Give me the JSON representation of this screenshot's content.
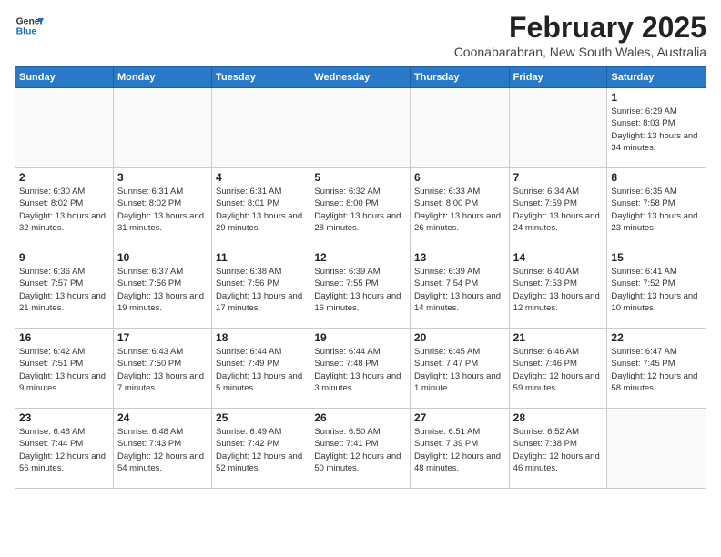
{
  "logo": {
    "line1": "General",
    "line2": "Blue"
  },
  "title": "February 2025",
  "location": "Coonabarabran, New South Wales, Australia",
  "days_of_week": [
    "Sunday",
    "Monday",
    "Tuesday",
    "Wednesday",
    "Thursday",
    "Friday",
    "Saturday"
  ],
  "weeks": [
    [
      {
        "day": "",
        "info": ""
      },
      {
        "day": "",
        "info": ""
      },
      {
        "day": "",
        "info": ""
      },
      {
        "day": "",
        "info": ""
      },
      {
        "day": "",
        "info": ""
      },
      {
        "day": "",
        "info": ""
      },
      {
        "day": "1",
        "info": "Sunrise: 6:29 AM\nSunset: 8:03 PM\nDaylight: 13 hours\nand 34 minutes."
      }
    ],
    [
      {
        "day": "2",
        "info": "Sunrise: 6:30 AM\nSunset: 8:02 PM\nDaylight: 13 hours\nand 32 minutes."
      },
      {
        "day": "3",
        "info": "Sunrise: 6:31 AM\nSunset: 8:02 PM\nDaylight: 13 hours\nand 31 minutes."
      },
      {
        "day": "4",
        "info": "Sunrise: 6:31 AM\nSunset: 8:01 PM\nDaylight: 13 hours\nand 29 minutes."
      },
      {
        "day": "5",
        "info": "Sunrise: 6:32 AM\nSunset: 8:00 PM\nDaylight: 13 hours\nand 28 minutes."
      },
      {
        "day": "6",
        "info": "Sunrise: 6:33 AM\nSunset: 8:00 PM\nDaylight: 13 hours\nand 26 minutes."
      },
      {
        "day": "7",
        "info": "Sunrise: 6:34 AM\nSunset: 7:59 PM\nDaylight: 13 hours\nand 24 minutes."
      },
      {
        "day": "8",
        "info": "Sunrise: 6:35 AM\nSunset: 7:58 PM\nDaylight: 13 hours\nand 23 minutes."
      }
    ],
    [
      {
        "day": "9",
        "info": "Sunrise: 6:36 AM\nSunset: 7:57 PM\nDaylight: 13 hours\nand 21 minutes."
      },
      {
        "day": "10",
        "info": "Sunrise: 6:37 AM\nSunset: 7:56 PM\nDaylight: 13 hours\nand 19 minutes."
      },
      {
        "day": "11",
        "info": "Sunrise: 6:38 AM\nSunset: 7:56 PM\nDaylight: 13 hours\nand 17 minutes."
      },
      {
        "day": "12",
        "info": "Sunrise: 6:39 AM\nSunset: 7:55 PM\nDaylight: 13 hours\nand 16 minutes."
      },
      {
        "day": "13",
        "info": "Sunrise: 6:39 AM\nSunset: 7:54 PM\nDaylight: 13 hours\nand 14 minutes."
      },
      {
        "day": "14",
        "info": "Sunrise: 6:40 AM\nSunset: 7:53 PM\nDaylight: 13 hours\nand 12 minutes."
      },
      {
        "day": "15",
        "info": "Sunrise: 6:41 AM\nSunset: 7:52 PM\nDaylight: 13 hours\nand 10 minutes."
      }
    ],
    [
      {
        "day": "16",
        "info": "Sunrise: 6:42 AM\nSunset: 7:51 PM\nDaylight: 13 hours\nand 9 minutes."
      },
      {
        "day": "17",
        "info": "Sunrise: 6:43 AM\nSunset: 7:50 PM\nDaylight: 13 hours\nand 7 minutes."
      },
      {
        "day": "18",
        "info": "Sunrise: 6:44 AM\nSunset: 7:49 PM\nDaylight: 13 hours\nand 5 minutes."
      },
      {
        "day": "19",
        "info": "Sunrise: 6:44 AM\nSunset: 7:48 PM\nDaylight: 13 hours\nand 3 minutes."
      },
      {
        "day": "20",
        "info": "Sunrise: 6:45 AM\nSunset: 7:47 PM\nDaylight: 13 hours\nand 1 minute."
      },
      {
        "day": "21",
        "info": "Sunrise: 6:46 AM\nSunset: 7:46 PM\nDaylight: 12 hours\nand 59 minutes."
      },
      {
        "day": "22",
        "info": "Sunrise: 6:47 AM\nSunset: 7:45 PM\nDaylight: 12 hours\nand 58 minutes."
      }
    ],
    [
      {
        "day": "23",
        "info": "Sunrise: 6:48 AM\nSunset: 7:44 PM\nDaylight: 12 hours\nand 56 minutes."
      },
      {
        "day": "24",
        "info": "Sunrise: 6:48 AM\nSunset: 7:43 PM\nDaylight: 12 hours\nand 54 minutes."
      },
      {
        "day": "25",
        "info": "Sunrise: 6:49 AM\nSunset: 7:42 PM\nDaylight: 12 hours\nand 52 minutes."
      },
      {
        "day": "26",
        "info": "Sunrise: 6:50 AM\nSunset: 7:41 PM\nDaylight: 12 hours\nand 50 minutes."
      },
      {
        "day": "27",
        "info": "Sunrise: 6:51 AM\nSunset: 7:39 PM\nDaylight: 12 hours\nand 48 minutes."
      },
      {
        "day": "28",
        "info": "Sunrise: 6:52 AM\nSunset: 7:38 PM\nDaylight: 12 hours\nand 46 minutes."
      },
      {
        "day": "",
        "info": ""
      }
    ]
  ]
}
